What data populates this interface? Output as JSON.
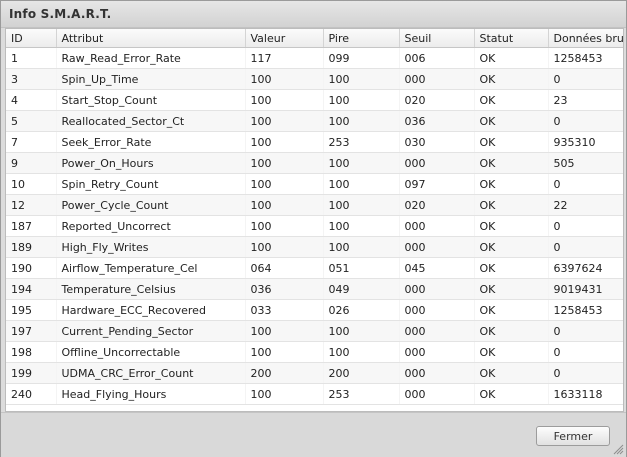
{
  "dialog": {
    "title": "Info S.M.A.R.T.",
    "close_label": "Fermer"
  },
  "table": {
    "headers": {
      "id": "ID",
      "attr": "Attribut",
      "val": "Valeur",
      "pire": "Pire",
      "seuil": "Seuil",
      "statut": "Statut",
      "data": "Données brutes"
    },
    "rows": [
      {
        "id": "1",
        "attr": "Raw_Read_Error_Rate",
        "val": "117",
        "pire": "099",
        "seuil": "006",
        "statut": "OK",
        "data": "1258453"
      },
      {
        "id": "3",
        "attr": "Spin_Up_Time",
        "val": "100",
        "pire": "100",
        "seuil": "000",
        "statut": "OK",
        "data": "0"
      },
      {
        "id": "4",
        "attr": "Start_Stop_Count",
        "val": "100",
        "pire": "100",
        "seuil": "020",
        "statut": "OK",
        "data": "23"
      },
      {
        "id": "5",
        "attr": "Reallocated_Sector_Ct",
        "val": "100",
        "pire": "100",
        "seuil": "036",
        "statut": "OK",
        "data": "0"
      },
      {
        "id": "7",
        "attr": "Seek_Error_Rate",
        "val": "100",
        "pire": "253",
        "seuil": "030",
        "statut": "OK",
        "data": "935310"
      },
      {
        "id": "9",
        "attr": "Power_On_Hours",
        "val": "100",
        "pire": "100",
        "seuil": "000",
        "statut": "OK",
        "data": "505"
      },
      {
        "id": "10",
        "attr": "Spin_Retry_Count",
        "val": "100",
        "pire": "100",
        "seuil": "097",
        "statut": "OK",
        "data": "0"
      },
      {
        "id": "12",
        "attr": "Power_Cycle_Count",
        "val": "100",
        "pire": "100",
        "seuil": "020",
        "statut": "OK",
        "data": "22"
      },
      {
        "id": "187",
        "attr": "Reported_Uncorrect",
        "val": "100",
        "pire": "100",
        "seuil": "000",
        "statut": "OK",
        "data": "0"
      },
      {
        "id": "189",
        "attr": "High_Fly_Writes",
        "val": "100",
        "pire": "100",
        "seuil": "000",
        "statut": "OK",
        "data": "0"
      },
      {
        "id": "190",
        "attr": "Airflow_Temperature_Cel",
        "val": "064",
        "pire": "051",
        "seuil": "045",
        "statut": "OK",
        "data": "6397624"
      },
      {
        "id": "194",
        "attr": "Temperature_Celsius",
        "val": "036",
        "pire": "049",
        "seuil": "000",
        "statut": "OK",
        "data": "9019431"
      },
      {
        "id": "195",
        "attr": "Hardware_ECC_Recovered",
        "val": "033",
        "pire": "026",
        "seuil": "000",
        "statut": "OK",
        "data": "1258453"
      },
      {
        "id": "197",
        "attr": "Current_Pending_Sector",
        "val": "100",
        "pire": "100",
        "seuil": "000",
        "statut": "OK",
        "data": "0"
      },
      {
        "id": "198",
        "attr": "Offline_Uncorrectable",
        "val": "100",
        "pire": "100",
        "seuil": "000",
        "statut": "OK",
        "data": "0"
      },
      {
        "id": "199",
        "attr": "UDMA_CRC_Error_Count",
        "val": "200",
        "pire": "200",
        "seuil": "000",
        "statut": "OK",
        "data": "0"
      },
      {
        "id": "240",
        "attr": "Head_Flying_Hours",
        "val": "100",
        "pire": "253",
        "seuil": "000",
        "statut": "OK",
        "data": "1633118"
      }
    ]
  },
  "icons": {
    "resize": "resize-grip-icon"
  }
}
